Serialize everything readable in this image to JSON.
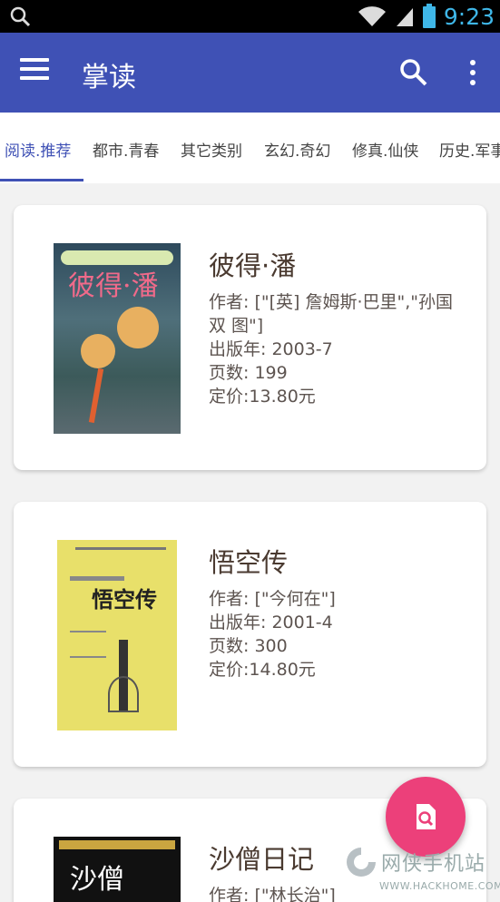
{
  "status_bar": {
    "time": "9:23",
    "icons": [
      "search-icon",
      "wifi-icon",
      "signal-icon",
      "battery-icon"
    ]
  },
  "app_bar": {
    "title": "掌读",
    "menu_icon": "menu-icon",
    "search_icon": "search-icon",
    "more_icon": "more-vert-icon",
    "color": "#3f51b5"
  },
  "tabs": [
    {
      "label": "阅读.推荐",
      "active": true
    },
    {
      "label": "都市.青春"
    },
    {
      "label": "其它类别"
    },
    {
      "label": "玄幻.奇幻"
    },
    {
      "label": "修真.仙侠"
    },
    {
      "label": "历史.军事"
    }
  ],
  "books": [
    {
      "title": "彼得·潘",
      "author": "作者: [\"[英] 詹姆斯·巴里\",\"孙国双 图\"]",
      "published": "出版年: 2003-7",
      "pages": "页数: 199",
      "price": "定价:13.80元",
      "cover_text": "彼得·潘"
    },
    {
      "title": "悟空传",
      "author": "作者: [\"今何在\"]",
      "published": "出版年: 2001-4",
      "pages": "页数: 300",
      "price": "定价:14.80元",
      "cover_text": "悟空传"
    },
    {
      "title": "沙僧日记",
      "author": "作者: [\"林长治\"]",
      "cover_text": "沙僧"
    }
  ],
  "fab": {
    "icon": "find-in-page-icon",
    "color": "#ec407a"
  },
  "watermark": {
    "name": "网侠手机站",
    "url": "WWW.HACKHOME.COM"
  }
}
